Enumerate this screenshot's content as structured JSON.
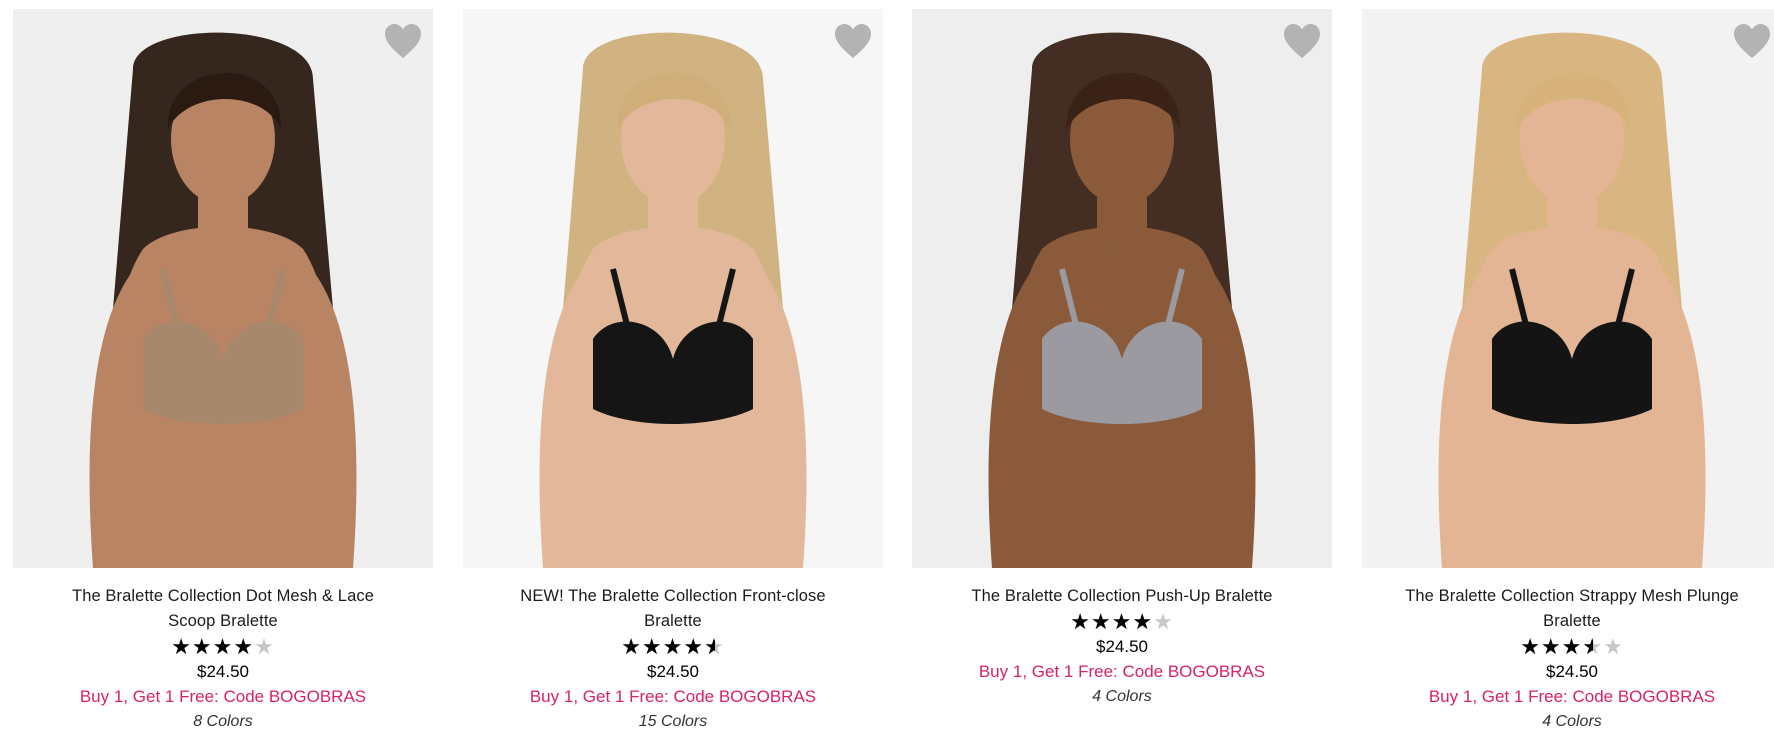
{
  "colors": {
    "promo": "#d6226b",
    "heart": "#b3b3b3",
    "star_filled": "#000000",
    "star_empty": "#c8c8c8"
  },
  "products": [
    {
      "name": "The Bralette Collection Dot Mesh & Lace Scoop Bralette",
      "rating_fraction": 0.8,
      "price": "$24.50",
      "promo": "Buy 1, Get 1 Free: Code BOGOBRAS",
      "colors": "8 Colors",
      "favorite_icon": "heart-icon",
      "garment_color": "#a8886c",
      "background": "#efefef",
      "hair": "#2a1a12",
      "skin": "#b88463"
    },
    {
      "name": "NEW! The Bralette Collection Front-close Bralette",
      "rating_fraction": 0.9,
      "price": "$24.50",
      "promo": "Buy 1, Get 1 Free: Code BOGOBRAS",
      "colors": "15 Colors",
      "favorite_icon": "heart-icon",
      "garment_color": "#151515",
      "background": "#f6f6f6",
      "hair": "#cfae7a",
      "skin": "#e3b89a"
    },
    {
      "name": "The Bralette Collection Push-Up Bralette",
      "rating_fraction": 0.8,
      "price": "$24.50",
      "promo": "Buy 1, Get 1 Free: Code BOGOBRAS",
      "colors": "4 Colors",
      "favorite_icon": "heart-icon",
      "garment_color": "#9a9aa0",
      "background": "#eeeeee",
      "hair": "#3a2216",
      "skin": "#8a5a3a"
    },
    {
      "name": "The Bralette Collection Strappy Mesh Plunge Bralette",
      "rating_fraction": 0.7,
      "price": "$24.50",
      "promo": "Buy 1, Get 1 Free: Code BOGOBRAS",
      "colors": "4 Colors",
      "favorite_icon": "heart-icon",
      "garment_color": "#141414",
      "background": "#f2f2f2",
      "hair": "#d7b27a",
      "skin": "#e4b594"
    }
  ]
}
